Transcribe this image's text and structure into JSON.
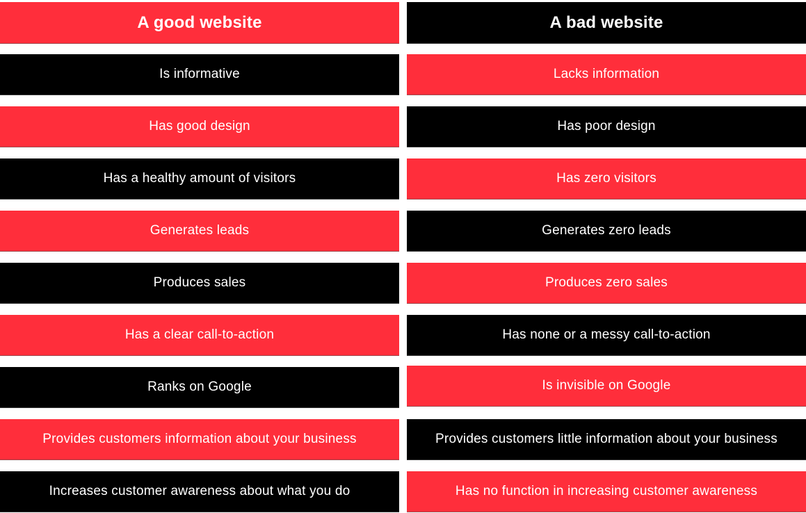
{
  "colors": {
    "red": "#ff2e3b",
    "black": "#000000",
    "text": "#ffffff"
  },
  "good": {
    "title": "A good website",
    "items": [
      "Is informative",
      "Has good design",
      "Has a healthy amount of visitors",
      "Generates leads",
      "Produces sales",
      "Has a clear call-to-action",
      "Ranks on Google",
      "Provides customers information about your business",
      "Increases customer awareness about what you do"
    ]
  },
  "bad": {
    "title": "A bad website",
    "items": [
      "Lacks information",
      "Has poor design",
      "Has zero visitors",
      "Generates zero leads",
      "Produces zero sales",
      "Has none or a messy call-to-action",
      "Is invisible on Google",
      "Provides customers little information about your business",
      "Has no function in increasing customer awareness"
    ]
  }
}
